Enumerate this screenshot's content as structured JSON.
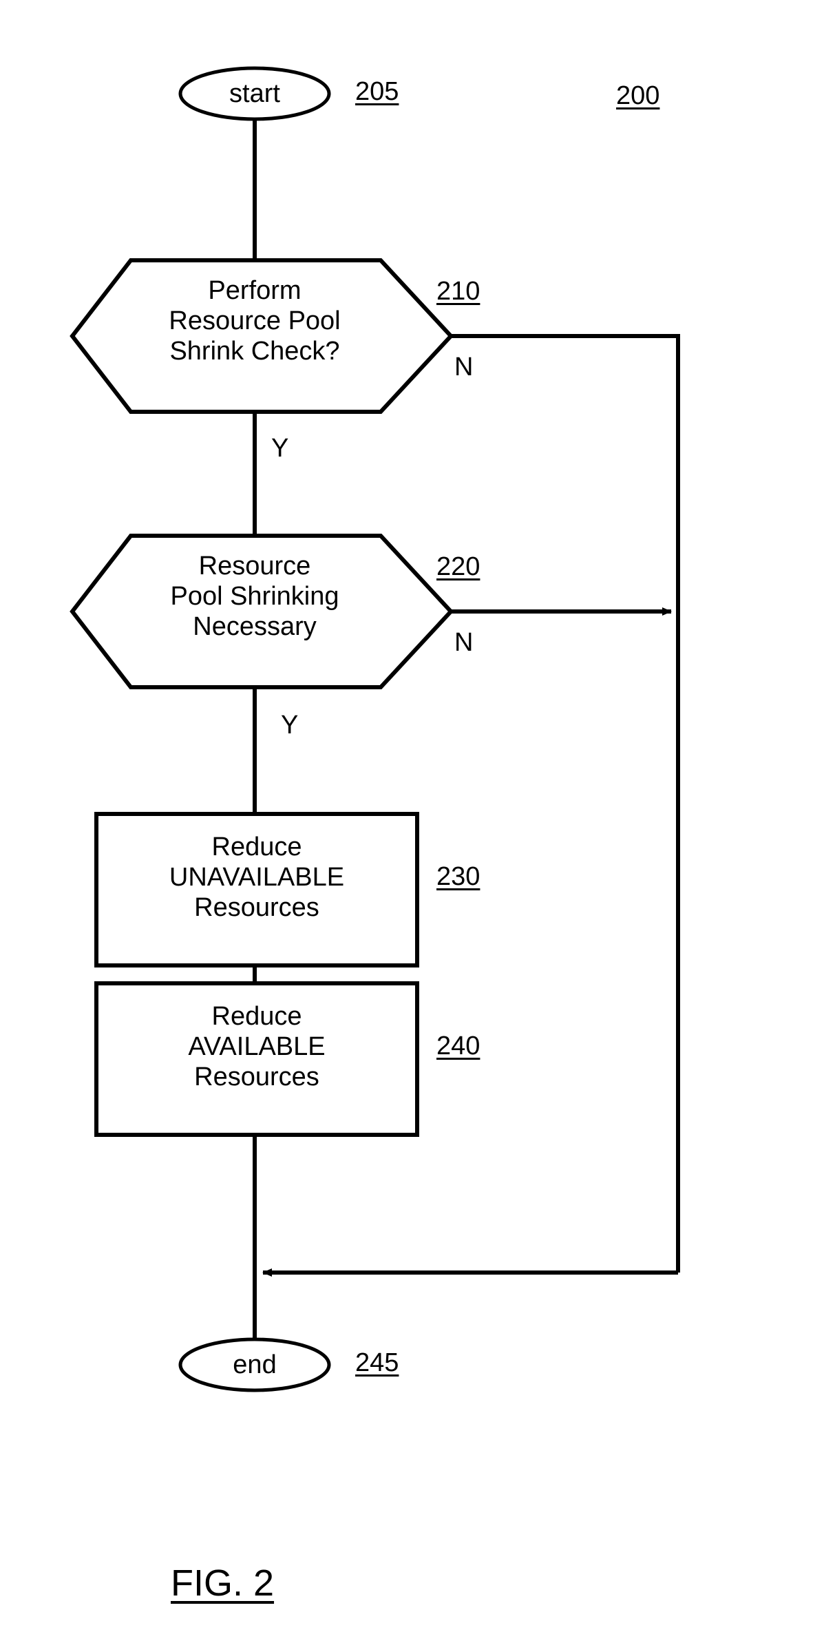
{
  "figure": {
    "caption": "FIG. 2",
    "figure_ref": "200"
  },
  "nodes": {
    "start": {
      "label": "start",
      "ref": "205",
      "shape": "ellipse"
    },
    "decision_210": {
      "line1": "Perform",
      "line2": "Resource Pool",
      "line3": "Shrink Check?",
      "ref": "210",
      "shape": "hexagon",
      "no_label": "N",
      "yes_label": "Y"
    },
    "decision_220": {
      "line1": "Resource",
      "line2": "Pool Shrinking",
      "line3": "Necessary",
      "ref": "220",
      "shape": "hexagon",
      "no_label": "N",
      "yes_label": "Y"
    },
    "process_230": {
      "line1": "Reduce",
      "line2": "UNAVAILABLE",
      "line3": "Resources",
      "ref": "230",
      "shape": "rectangle"
    },
    "process_240": {
      "line1": "Reduce",
      "line2": "AVAILABLE",
      "line3": "Resources",
      "ref": "240",
      "shape": "rectangle"
    },
    "end": {
      "label": "end",
      "ref": "245",
      "shape": "ellipse"
    }
  },
  "colors": {
    "stroke": "#000000",
    "background": "#ffffff",
    "text": "#000000"
  }
}
